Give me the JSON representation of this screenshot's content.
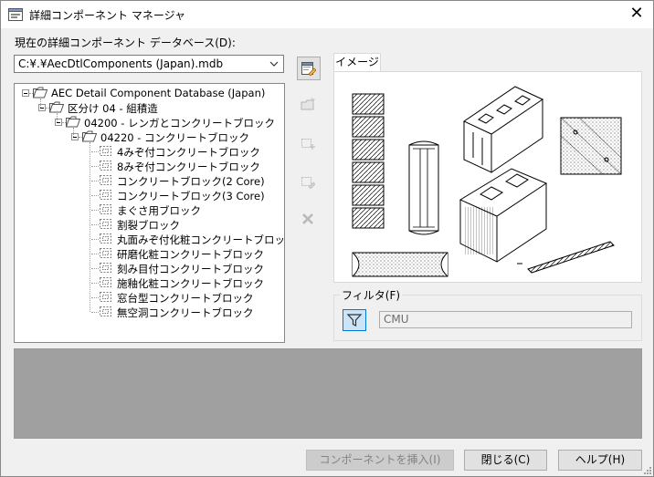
{
  "window": {
    "title": "詳細コンポーネント マネージャ"
  },
  "database": {
    "label": "現在の詳細コンポーネント データベース(D):",
    "value": "C:¥.¥AecDtlComponents (Japan).mdb"
  },
  "tree": [
    {
      "label": "AEC Detail Component Database (Japan)",
      "level": 0,
      "type": "folder"
    },
    {
      "label": "区分け 04 - 組積造",
      "level": 1,
      "type": "folder"
    },
    {
      "label": "04200 - レンガとコンクリートブロック",
      "level": 2,
      "type": "folder"
    },
    {
      "label": "04220 - コンクリートブロック",
      "level": 3,
      "type": "folder"
    },
    {
      "label": "4みぞ付コンクリートブロック",
      "level": 4,
      "type": "leaf"
    },
    {
      "label": "8みぞ付コンクリートブロック",
      "level": 4,
      "type": "leaf"
    },
    {
      "label": "コンクリートブロック(2 Core)",
      "level": 4,
      "type": "leaf"
    },
    {
      "label": "コンクリートブロック(3 Core)",
      "level": 4,
      "type": "leaf"
    },
    {
      "label": "まぐさ用ブロック",
      "level": 4,
      "type": "leaf"
    },
    {
      "label": "割裂ブロック",
      "level": 4,
      "type": "leaf"
    },
    {
      "label": "丸面みぞ付化粧コンクリートブロック",
      "level": 4,
      "type": "leaf"
    },
    {
      "label": "研磨化粧コンクリートブロック",
      "level": 4,
      "type": "leaf"
    },
    {
      "label": "刻み目付コンクリートブロック",
      "level": 4,
      "type": "leaf"
    },
    {
      "label": "施釉化粧コンクリートブロック",
      "level": 4,
      "type": "leaf"
    },
    {
      "label": "窓台型コンクリートブロック",
      "level": 4,
      "type": "leaf"
    },
    {
      "label": "無空洞コンクリートブロック",
      "level": 4,
      "type": "leaf"
    }
  ],
  "toolbar": [
    {
      "name": "edit-database-button",
      "icon": "edit-database-icon",
      "enabled": true
    },
    {
      "name": "new-group-button",
      "icon": "new-folder-icon",
      "enabled": false
    },
    {
      "name": "new-component-button",
      "icon": "add-component-icon",
      "enabled": false
    },
    {
      "name": "edit-component-button",
      "icon": "edit-component-icon",
      "enabled": false
    },
    {
      "name": "delete-button",
      "icon": "delete-icon",
      "enabled": false
    }
  ],
  "preview": {
    "tab_label": "イメージ"
  },
  "filter": {
    "label": "フィルタ(F)",
    "value": "CMU"
  },
  "buttons": {
    "insert": "コンポーネントを挿入(I)",
    "close": "閉じる(C)",
    "help": "ヘルプ(H)"
  },
  "colors": {
    "accent": "#0078d7",
    "description_bg": "#a0a0a0"
  }
}
